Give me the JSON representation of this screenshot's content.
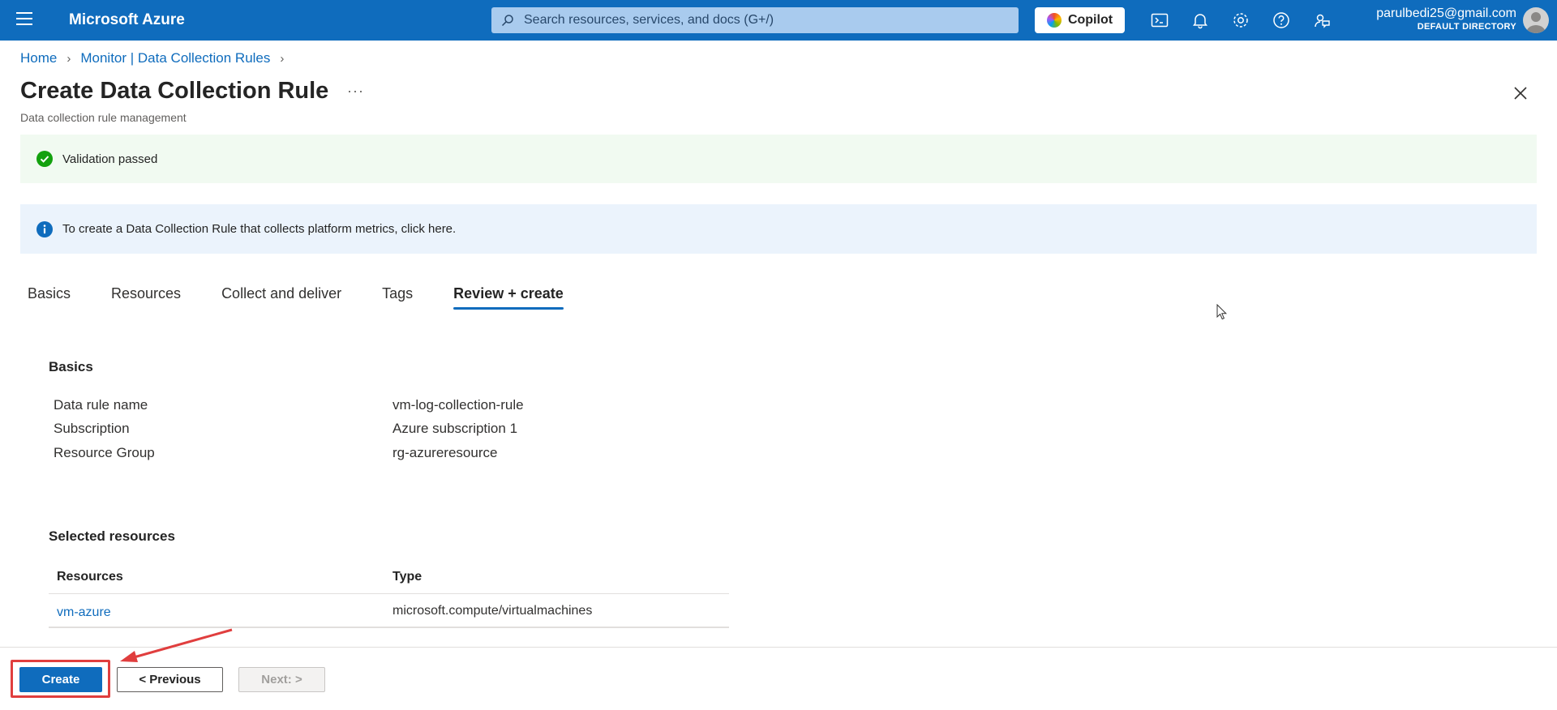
{
  "topbar": {
    "brand": "Microsoft Azure",
    "search_placeholder": "Search resources, services, and docs (G+/)",
    "copilot_label": "Copilot",
    "account_email": "parulbedi25@gmail.com",
    "account_directory": "DEFAULT DIRECTORY",
    "icons": [
      "cloud-shell-icon",
      "bell-icon",
      "gear-icon",
      "help-icon",
      "feedback-icon"
    ]
  },
  "breadcrumb": {
    "items": [
      "Home",
      "Monitor | Data Collection Rules"
    ]
  },
  "page": {
    "title": "Create Data Collection Rule",
    "subtitle": "Data collection rule management",
    "more_label": "···"
  },
  "banners": {
    "success": "Validation passed",
    "info": "To create a Data Collection Rule that collects platform metrics, click here."
  },
  "tabs": [
    {
      "label": "Basics",
      "active": false
    },
    {
      "label": "Resources",
      "active": false
    },
    {
      "label": "Collect and deliver",
      "active": false
    },
    {
      "label": "Tags",
      "active": false
    },
    {
      "label": "Review + create",
      "active": true
    }
  ],
  "basics": {
    "heading": "Basics",
    "rows": [
      {
        "label": "Data rule name",
        "value": "vm-log-collection-rule"
      },
      {
        "label": "Subscription",
        "value": "Azure subscription 1"
      },
      {
        "label": "Resource Group",
        "value": "rg-azureresource"
      }
    ]
  },
  "selected_resources": {
    "heading": "Selected resources",
    "columns": [
      "Resources",
      "Type"
    ],
    "rows": [
      {
        "resource": "vm-azure",
        "type": "microsoft.compute/virtualmachines"
      }
    ]
  },
  "footer": {
    "create_label": "Create",
    "previous_label": "< Previous",
    "next_label": "Next: >"
  },
  "colors": {
    "accent": "#0f6cbd",
    "success": "#13a10e",
    "annotation": "#e03e3e"
  }
}
